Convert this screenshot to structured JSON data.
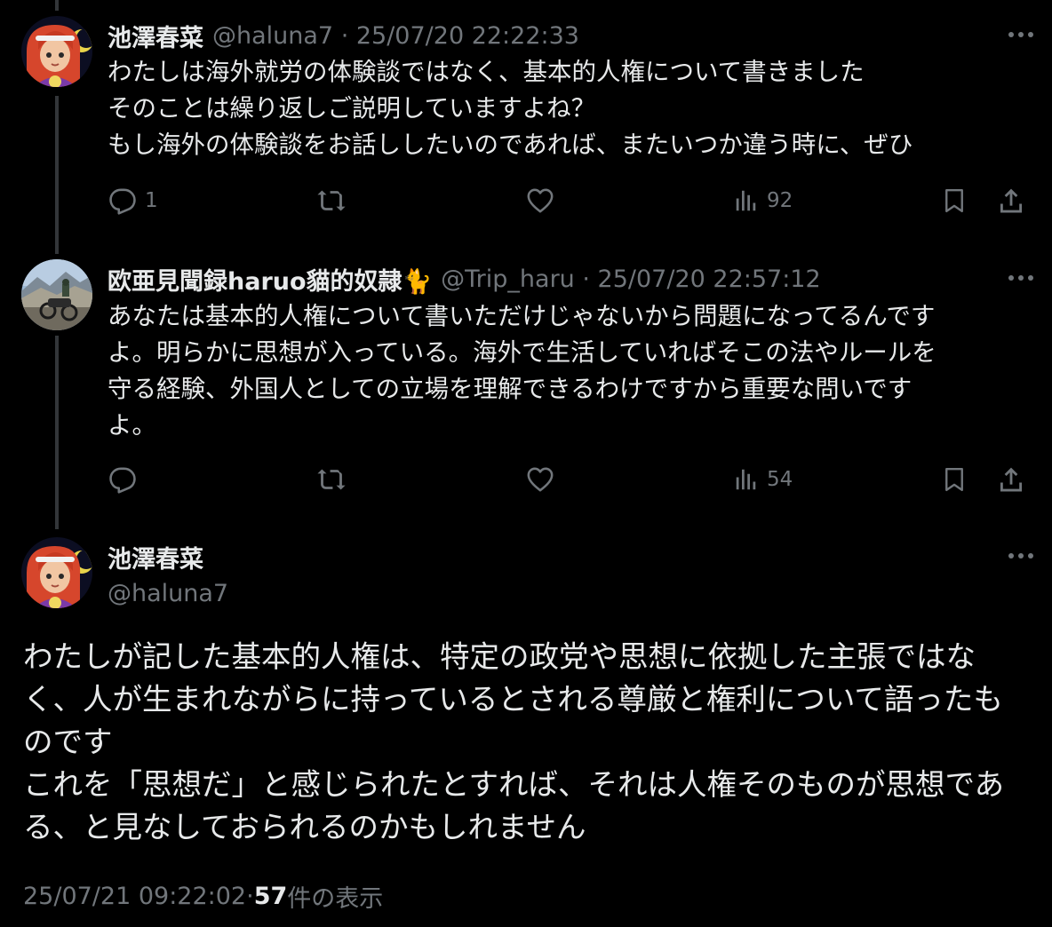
{
  "tweets": [
    {
      "author_name": "池澤春菜",
      "meta": "@haluna7 · 25/07/20 22:22:33",
      "lines": [
        "わたしは海外就労の体験談ではなく、基本的人権について書きました",
        "そのことは繰り返しご説明していますよね？",
        "もし海外の体験談をお話ししたいのであれば、またいつか違う時に、ぜひ"
      ],
      "reply_count": "1",
      "view_count": "92"
    },
    {
      "author_name": "欧亜見聞録haruo貓的奴隷🐈",
      "meta": "@Trip_haru · 25/07/20 22:57:12",
      "lines": [
        "あなたは基本的人権について書いただけじゃないから問題になってるんです",
        "よ。明らかに思想が入っている。海外で生活していればそこの法やルールを",
        "守る経験、外国人としての立場を理解できるわけですから重要な問いです",
        "よ。"
      ],
      "reply_count": "",
      "view_count": "54"
    }
  ],
  "main_tweet": {
    "author_name": "池澤春菜",
    "handle": "@haluna7",
    "lines": [
      "わたしが記した基本的人権は、特定の政党や思想に依拠した主張ではな",
      "く、人が生まれながらに持っているとされる尊厳と権利について語ったも",
      "のです",
      "これを「思想だ」と感じられたとすれば、それは人権そのものが思想であ",
      "る、と見なしておられるのかもしれません"
    ],
    "timestamp": "25/07/21 09:22:02",
    "separator": " · ",
    "views_count": "57",
    "views_label": " 件の表示"
  },
  "icons": {
    "more": "more-dots-icon",
    "reply": "reply-bubble-icon",
    "retweet": "retweet-arrows-icon",
    "like": "heart-icon",
    "views": "bar-chart-icon",
    "bookmark": "bookmark-icon",
    "share": "share-upload-icon"
  },
  "colors": {
    "background": "#000000",
    "text": "#e7e9ea",
    "muted": "#71767b",
    "thread_line": "#333639"
  }
}
